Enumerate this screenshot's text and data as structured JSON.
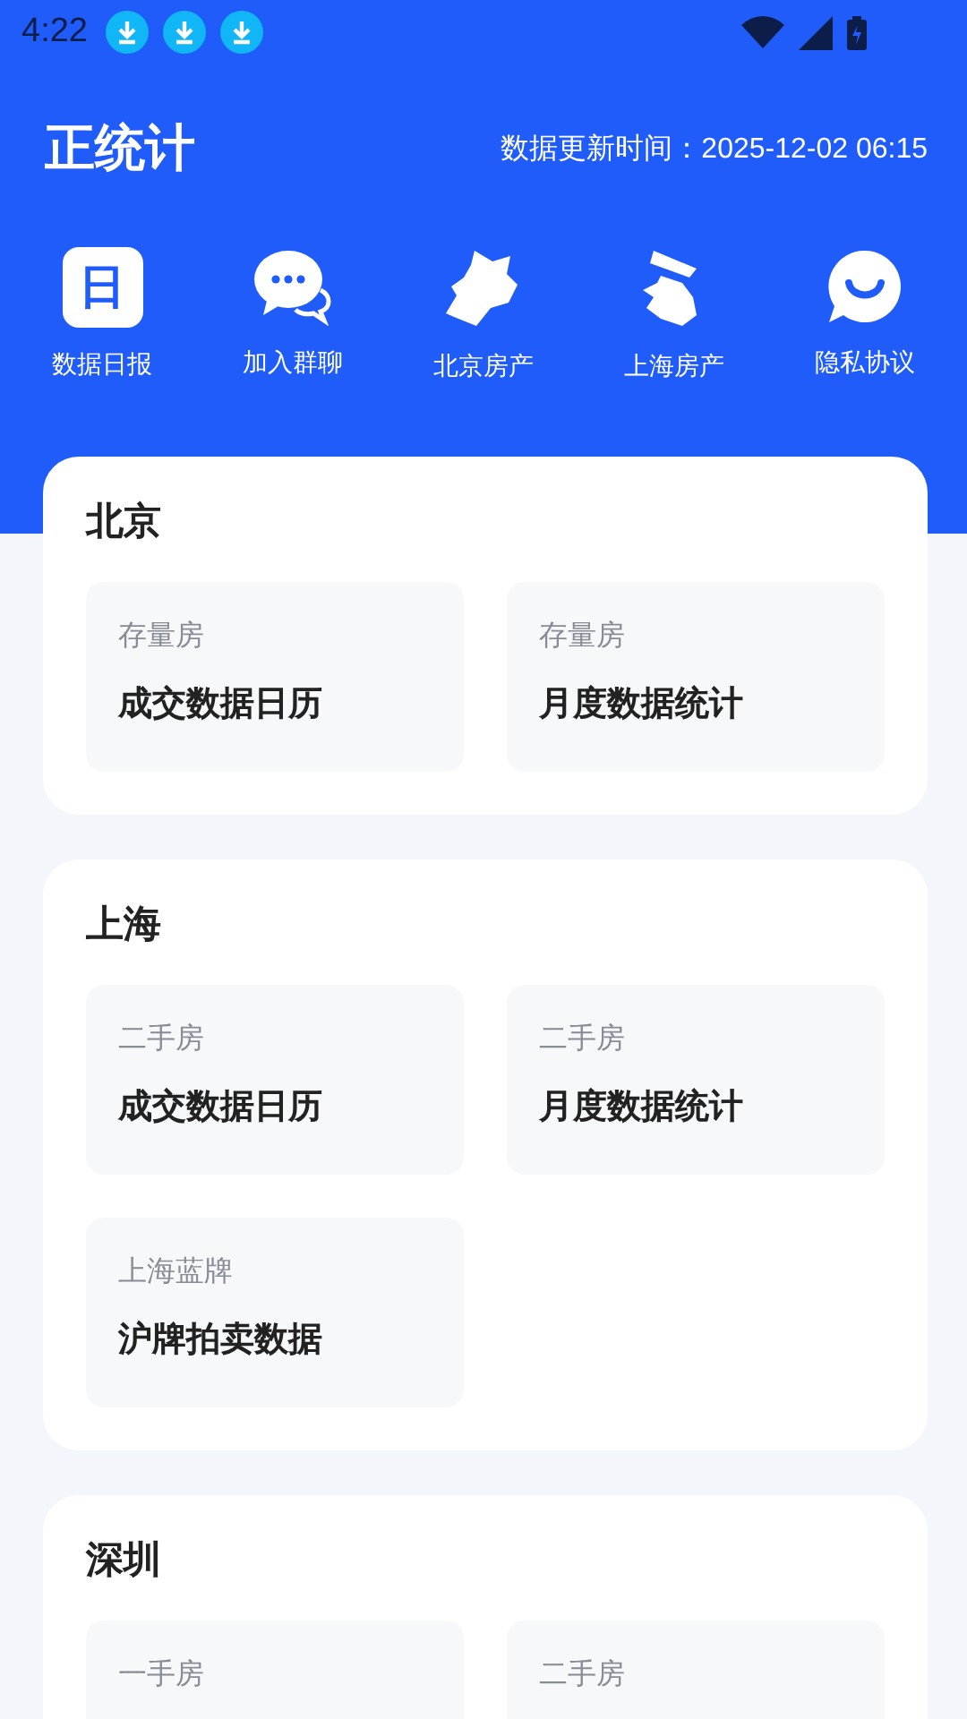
{
  "status_bar": {
    "time": "4:22",
    "notifications": [
      {
        "kind": "download"
      },
      {
        "kind": "download"
      },
      {
        "kind": "download"
      }
    ]
  },
  "header": {
    "title": "正统计",
    "updated": "数据更新时间：2025-12-02 06:15"
  },
  "shortcuts": [
    {
      "kind": "calendar",
      "glyph": "日",
      "label": "数据日报"
    },
    {
      "kind": "chat",
      "label": "加入群聊"
    },
    {
      "kind": "beijing",
      "label": "北京房产"
    },
    {
      "kind": "shanghai",
      "label": "上海房产"
    },
    {
      "kind": "smile",
      "label": "隐私协议"
    }
  ],
  "sections": [
    {
      "city": "北京",
      "tiles": [
        {
          "subtitle": "存量房",
          "title": "成交数据日历"
        },
        {
          "subtitle": "存量房",
          "title": "月度数据统计"
        }
      ]
    },
    {
      "city": "上海",
      "tiles": [
        {
          "subtitle": "二手房",
          "title": "成交数据日历"
        },
        {
          "subtitle": "二手房",
          "title": "月度数据统计"
        },
        {
          "subtitle": "上海蓝牌",
          "title": "沪牌拍卖数据"
        }
      ]
    },
    {
      "city": "深圳",
      "tiles": [
        {
          "subtitle": "一手房"
        },
        {
          "subtitle": "二手房"
        }
      ]
    }
  ]
}
